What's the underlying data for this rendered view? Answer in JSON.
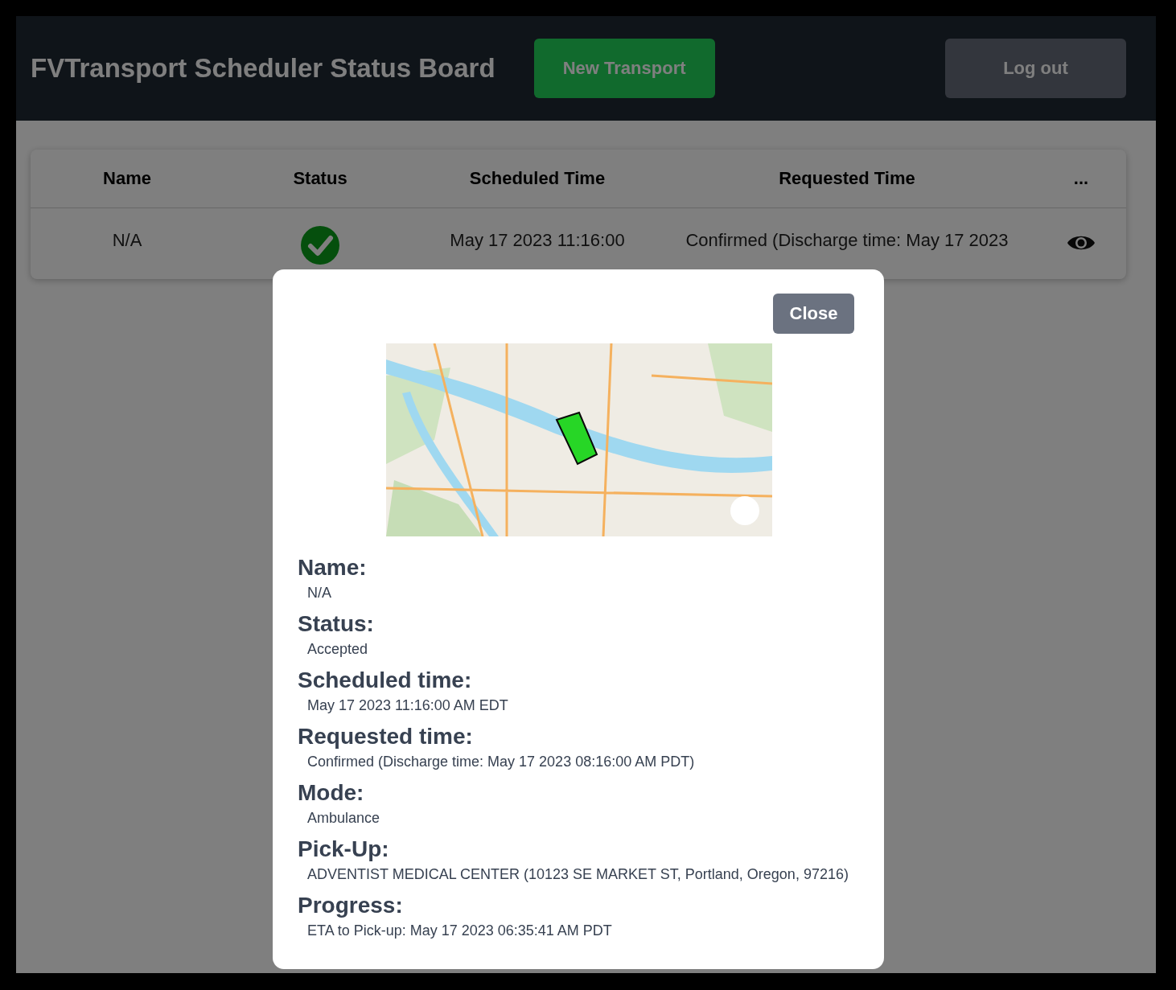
{
  "header": {
    "title": "FVTransport Scheduler Status Board",
    "buttons": [
      {
        "label": "New Transport",
        "kind": "primary"
      },
      {
        "label": "Log out",
        "kind": "secondary"
      }
    ]
  },
  "table": {
    "columns": [
      "Name",
      "Status",
      "Scheduled Time",
      "Requested Time",
      "..."
    ],
    "rows": [
      {
        "name": "N/A",
        "accepted": true,
        "scheduled_time": "May 17 2023 11:16:00",
        "requested_time": "Confirmed (Discharge time: May 17 2023"
      }
    ]
  },
  "modal": {
    "close_label": "Close",
    "fields": [
      {
        "label": "Name:",
        "value": "N/A"
      },
      {
        "label": "Status:",
        "value": "Accepted"
      },
      {
        "label": "Scheduled time:",
        "value": "May 17 2023 11:16:00 AM EDT"
      },
      {
        "label": "Requested time:",
        "value": "Confirmed (Discharge time: May 17 2023 08:16:00 AM PDT)"
      },
      {
        "label": "Mode:",
        "value": "Ambulance"
      },
      {
        "label": "Pick-Up:",
        "value": "ADVENTIST MEDICAL CENTER (10123 SE MARKET ST, Portland, Oregon, 97216)"
      },
      {
        "label": "Progress:",
        "value": "ETA to Pick-up: May 17 2023 06:35:41 AM PDT"
      }
    ]
  }
}
